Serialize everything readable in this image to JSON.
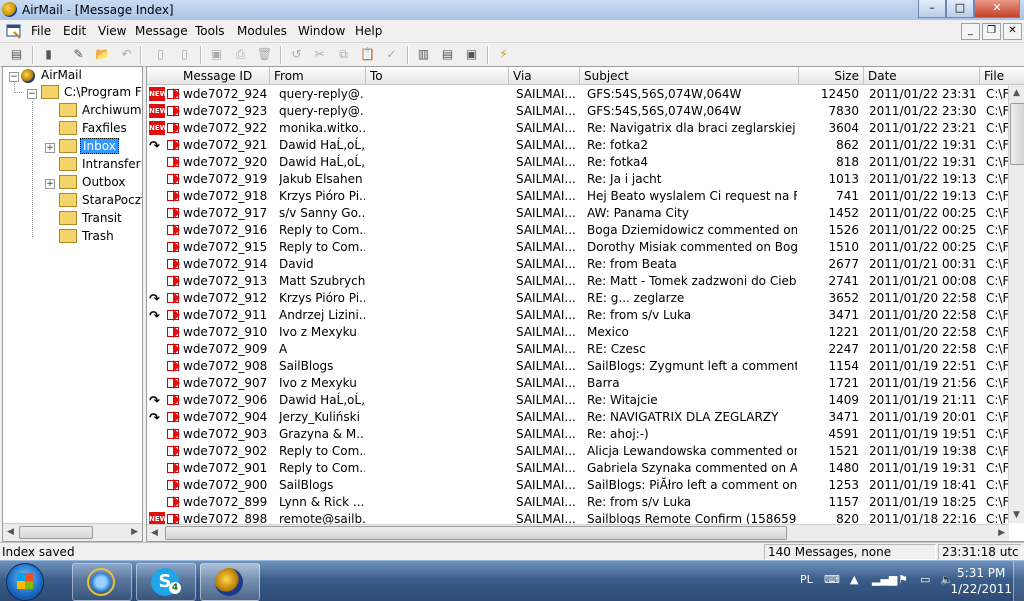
{
  "window": {
    "title": "AirMail - [Message Index]",
    "min": "–",
    "max": "□",
    "close": "✕"
  },
  "menu": [
    "File",
    "Edit",
    "View",
    "Message",
    "Tools",
    "Modules",
    "Window",
    "Help"
  ],
  "mdi": {
    "min": "_",
    "restore": "❐",
    "close": "✕"
  },
  "tree": {
    "root": "AirMail",
    "path": "C:\\Program Fil",
    "folders": [
      "Archiwum",
      "Faxfiles",
      "Inbox",
      "Intransfer",
      "Outbox",
      "StaraPoczta",
      "Transit",
      "Trash"
    ],
    "selected": "Inbox"
  },
  "columns": [
    "Message ID",
    "From",
    "To",
    "Via",
    "Subject",
    "Size",
    "Date",
    "File"
  ],
  "rows": [
    {
      "icon": "new",
      "id": "wde7072_924",
      "from": "query-reply@...",
      "via": "SAILMAI...",
      "subject": "GFS:54S,56S,074W,064W",
      "size": "12450",
      "date": "2011/01/22 23:31:04",
      "file": "C:\\F"
    },
    {
      "icon": "new",
      "id": "wde7072_923",
      "from": "query-reply@...",
      "via": "SAILMAI...",
      "subject": "GFS:54S,56S,074W,064W",
      "size": "7830",
      "date": "2011/01/22 23:30:48",
      "file": "C:\\F"
    },
    {
      "icon": "new",
      "id": "wde7072_922",
      "from": "monika.witko...",
      "via": "SAILMAI...",
      "subject": "Re: Navigatrix dla braci zeglarskiej",
      "size": "3604",
      "date": "2011/01/22 23:21:04",
      "file": "C:\\F"
    },
    {
      "icon": "reply",
      "id": "wde7072_921",
      "from": "Dawid HaĹ‚oĹ„",
      "via": "SAILMAI...",
      "subject": "Re: fotka2",
      "size": "862",
      "date": "2011/01/22 19:31:16",
      "file": "C:\\F"
    },
    {
      "icon": "read",
      "id": "wde7072_920",
      "from": "Dawid HaĹ‚oĹ„",
      "via": "SAILMAI...",
      "subject": "Re: fotka4",
      "size": "818",
      "date": "2011/01/22 19:31:16",
      "file": "C:\\F"
    },
    {
      "icon": "read",
      "id": "wde7072_919",
      "from": "Jakub Elsahen",
      "via": "SAILMAI...",
      "subject": "Re: Ja i jacht",
      "size": "1013",
      "date": "2011/01/22 19:13:42",
      "file": "C:\\F"
    },
    {
      "icon": "read",
      "id": "wde7072_918",
      "from": "Krzys Pióro Pi...",
      "via": "SAILMAI...",
      "subject": "Hej Beato wyslalem Ci request na FB ...",
      "size": "741",
      "date": "2011/01/22 19:13:42",
      "file": "C:\\F"
    },
    {
      "icon": "read",
      "id": "wde7072_917",
      "from": "s/v Sanny Go...",
      "via": "SAILMAI...",
      "subject": "AW: Panama City",
      "size": "1452",
      "date": "2011/01/22 00:25:30",
      "file": "C:\\F"
    },
    {
      "icon": "read",
      "id": "wde7072_916",
      "from": "Reply to Com...",
      "via": "SAILMAI...",
      "subject": "Boga Dziemidowicz commented on h...",
      "size": "1526",
      "date": "2011/01/22 00:25:30",
      "file": "C:\\F"
    },
    {
      "icon": "read",
      "id": "wde7072_915",
      "from": "Reply to Com...",
      "via": "SAILMAI...",
      "subject": "Dorothy Misiak commented on Boga ...",
      "size": "1510",
      "date": "2011/01/22 00:25:30",
      "file": "C:\\F"
    },
    {
      "icon": "read",
      "id": "wde7072_914",
      "from": "David",
      "via": "SAILMAI...",
      "subject": "Re: from Beata",
      "size": "2677",
      "date": "2011/01/21 00:31:04",
      "file": "C:\\F"
    },
    {
      "icon": "read",
      "id": "wde7072_913",
      "from": "Matt Szubrycht",
      "via": "SAILMAI...",
      "subject": "Re: Matt - Tomek zadzwoni do Ciebie...",
      "size": "2741",
      "date": "2011/01/21 00:08:04",
      "file": "C:\\F"
    },
    {
      "icon": "reply",
      "id": "wde7072_912",
      "from": "Krzys Pióro Pi...",
      "via": "SAILMAI...",
      "subject": "RE: g... zeglarze",
      "size": "3652",
      "date": "2011/01/20 22:58:06",
      "file": "C:\\F"
    },
    {
      "icon": "reply",
      "id": "wde7072_911",
      "from": "Andrzej Lizini...",
      "via": "SAILMAI...",
      "subject": "Re: from s/v Luka",
      "size": "3471",
      "date": "2011/01/20 22:58:06",
      "file": "C:\\F"
    },
    {
      "icon": "read",
      "id": "wde7072_910",
      "from": "Ivo z Mexyku",
      "via": "SAILMAI...",
      "subject": "Mexico",
      "size": "1221",
      "date": "2011/01/20 22:58:06",
      "file": "C:\\F"
    },
    {
      "icon": "read",
      "id": "wde7072_909",
      "from": "A",
      "via": "SAILMAI...",
      "subject": "RE: Czesc",
      "size": "2247",
      "date": "2011/01/20 22:58:06",
      "file": "C:\\F"
    },
    {
      "icon": "read",
      "id": "wde7072_908",
      "from": "SailBlogs",
      "via": "SAILMAI...",
      "subject": "SailBlogs: Zygmunt left a comment o...",
      "size": "1154",
      "date": "2011/01/19 22:51:16",
      "file": "C:\\F"
    },
    {
      "icon": "read",
      "id": "wde7072_907",
      "from": "Ivo z Mexyku",
      "via": "SAILMAI...",
      "subject": "Barra",
      "size": "1721",
      "date": "2011/01/19 21:56:58",
      "file": "C:\\F"
    },
    {
      "icon": "reply",
      "id": "wde7072_906",
      "from": "Dawid HaĹ‚oĹ„",
      "via": "SAILMAI...",
      "subject": "Re: Witajcie",
      "size": "1409",
      "date": "2011/01/19 21:11:04",
      "file": "C:\\F"
    },
    {
      "icon": "reply",
      "id": "wde7072_904",
      "from": "Jerzy_Kuliński",
      "via": "SAILMAI...",
      "subject": "Re: NAVIGATRIX DLA ZEGLARZY",
      "size": "3471",
      "date": "2011/01/19 20:01:04",
      "file": "C:\\F"
    },
    {
      "icon": "read",
      "id": "wde7072_903",
      "from": "Grazyna & M...",
      "via": "SAILMAI...",
      "subject": "Re: ahoj:-)",
      "size": "4591",
      "date": "2011/01/19 19:51:02",
      "file": "C:\\F"
    },
    {
      "icon": "read",
      "id": "wde7072_902",
      "from": "Reply to Com...",
      "via": "SAILMAI...",
      "subject": "Alicja Lewandowska commented on ...",
      "size": "1521",
      "date": "2011/01/19 19:38:40",
      "file": "C:\\F"
    },
    {
      "icon": "read",
      "id": "wde7072_901",
      "from": "Reply to Com...",
      "via": "SAILMAI...",
      "subject": "Gabriela Szynaka commented on Alic...",
      "size": "1480",
      "date": "2011/01/19 19:31:04",
      "file": "C:\\F"
    },
    {
      "icon": "read",
      "id": "wde7072_900",
      "from": "SailBlogs",
      "via": "SAILMAI...",
      "subject": "SailBlogs: PiĂłro left a comment on y...",
      "size": "1253",
      "date": "2011/01/19 18:41:02",
      "file": "C:\\F"
    },
    {
      "icon": "read",
      "id": "wde7072_899",
      "from": "Lynn & Rick ...",
      "via": "SAILMAI...",
      "subject": "Re: from s/v Luka",
      "size": "1157",
      "date": "2011/01/19 18:25:52",
      "file": "C:\\F"
    },
    {
      "icon": "new",
      "id": "wde7072_898",
      "from": "remote@sailb...",
      "via": "SAILMAI...",
      "subject": "Sailblogs Remote Confirm (158659)",
      "size": "820",
      "date": "2011/01/18 22:16:50",
      "file": "C:\\F"
    }
  ],
  "status": {
    "left": "Index saved",
    "count": "140 Messages, none selected",
    "time": "23:31:18 utc"
  },
  "taskbar": {
    "lang": "PL",
    "time": "5:31 PM",
    "date": "1/22/2011",
    "skype_badge": "4"
  },
  "icons": {
    "new": "new-mail-icon",
    "reply": "replied-icon",
    "read": "mail-icon"
  },
  "colors": {
    "selection": "#3399ff",
    "arrow": "#e01010",
    "taskbar": "#3b5d8a"
  }
}
